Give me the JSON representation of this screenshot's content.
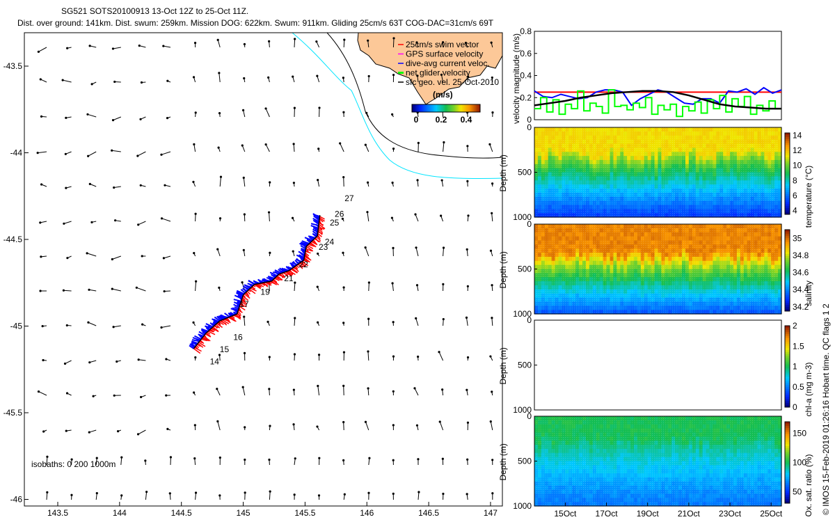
{
  "title": {
    "line1": "SG521 SOTS20100913 13-Oct 12Z to 25-Oct 11Z.",
    "line2": "Dist. over ground: 141km. Dist. swum: 259km. Mission DOG: 622km. Swum: 911km. Gliding 25cm/s 63T COG-DAC=31cm/s 69T"
  },
  "colors": {
    "swim": "#ff0000",
    "gps": "#ff00ff",
    "dac": "#0000ff",
    "net": "#00ff00",
    "geo": "#000000",
    "land": "#fcc898",
    "isobath200": "#00e5ff",
    "isobath1000": "#000000"
  },
  "chart_data": [
    {
      "type": "map",
      "name": "track-map",
      "xlim": [
        143.2,
        147.1
      ],
      "ylim": [
        -46.05,
        -43.3
      ],
      "xticks": [
        "143.5",
        "144",
        "144.5",
        "145",
        "145.5",
        "146",
        "146.5",
        "147"
      ],
      "xtick_values": [
        143.5,
        144,
        144.5,
        145,
        145.5,
        146,
        146.5,
        147
      ],
      "yticks": [
        "-43.5",
        "-44",
        "-44.5",
        "-45",
        "-45.5",
        "-46"
      ],
      "ytick_values": [
        -43.5,
        -44,
        -44.5,
        -45,
        -45.5,
        -46
      ],
      "track": [
        [
          144.6,
          -45.13
        ],
        [
          144.7,
          -45.04
        ],
        [
          144.81,
          -44.97
        ],
        [
          144.95,
          -44.93
        ],
        [
          145.0,
          -44.82
        ],
        [
          145.09,
          -44.76
        ],
        [
          145.23,
          -44.74
        ],
        [
          145.29,
          -44.7
        ],
        [
          145.37,
          -44.68
        ],
        [
          145.49,
          -44.62
        ],
        [
          145.51,
          -44.54
        ],
        [
          145.6,
          -44.48
        ],
        [
          145.62,
          -44.36
        ]
      ],
      "day_labels": [
        {
          "label": "14",
          "lon": 144.73,
          "lat": -45.22
        },
        {
          "label": "15",
          "lon": 144.81,
          "lat": -45.15
        },
        {
          "label": "16",
          "lon": 144.92,
          "lat": -45.08
        },
        {
          "label": "17",
          "lon": 144.97,
          "lat": -44.89
        },
        {
          "label": "19",
          "lon": 145.14,
          "lat": -44.82
        },
        {
          "label": "21",
          "lon": 145.33,
          "lat": -44.74
        },
        {
          "label": "22",
          "lon": 145.45,
          "lat": -44.66
        },
        {
          "label": "23",
          "lon": 145.61,
          "lat": -44.56
        },
        {
          "label": "24",
          "lon": 145.66,
          "lat": -44.53
        },
        {
          "label": "25",
          "lon": 145.7,
          "lat": -44.42
        },
        {
          "label": "26",
          "lon": 145.74,
          "lat": -44.37
        },
        {
          "label": "27",
          "lon": 145.82,
          "lat": -44.28
        }
      ],
      "legend": [
        "25cm/s swim vector",
        "GPS surface velocity",
        "dive-avg current veloc.",
        "net glider velocity",
        "sfc geo. vel. 25-Oct-2010"
      ],
      "colorbar": {
        "label": "(m/s)",
        "ticks": [
          "0",
          "0.2",
          "0.4"
        ],
        "range": [
          0,
          0.5
        ]
      },
      "isobaths_label": "isobaths: 0   200  1000m"
    },
    {
      "type": "line",
      "name": "velocity-magnitude",
      "ylabel": "velocity magnitude (m/s)",
      "ylim": [
        0,
        0.8
      ],
      "yticks": [
        "0",
        "0.2",
        "0.4",
        "0.6",
        "0.8"
      ],
      "xlim_days": [
        0,
        12
      ],
      "series": [
        {
          "name": "swim",
          "color": "#ff0000",
          "values": [
            0.25,
            0.25
          ]
        },
        {
          "name": "dive-avg current",
          "color": "#0000ff",
          "values": [
            0.26,
            0.21,
            0.2,
            0.23,
            0.21,
            0.19,
            0.2,
            0.25,
            0.27,
            0.27,
            0.25,
            0.13,
            0.19,
            0.23,
            0.27,
            0.25,
            0.2,
            0.15,
            0.14,
            0.19,
            0.19,
            0.15,
            0.26,
            0.25,
            0.28,
            0.23,
            0.29,
            0.24,
            0.27
          ]
        },
        {
          "name": "net glider",
          "color": "#00ff00",
          "values": [
            0.1,
            0.2,
            0.07,
            0.18,
            0.05,
            0.14,
            0.1,
            0.26,
            0.08,
            0.15,
            0.12,
            0.06,
            0.27,
            0.12,
            0.13,
            0.09,
            0.15,
            0.11,
            0.2,
            0.05,
            0.13,
            0.09,
            0.14,
            0.03,
            0.12,
            0.08,
            0.16,
            0.06,
            0.18,
            0.1,
            0.22,
            0.07,
            0.19,
            0.12,
            0.21,
            0.05,
            0.13,
            0.08,
            0.17,
            0.1
          ]
        },
        {
          "name": "geostrophic",
          "color": "#000000",
          "values": [
            0.13,
            0.15,
            0.17,
            0.2,
            0.22,
            0.24,
            0.25,
            0.26,
            0.26,
            0.25,
            0.22,
            0.18,
            0.14,
            0.12,
            0.11,
            0.1,
            0.1
          ]
        }
      ]
    },
    {
      "type": "heatmap",
      "name": "temperature-section",
      "ylabel": "Depth (m)",
      "yticks": [
        "0",
        "500",
        "1000"
      ],
      "cbar_label": "temperature (°C)",
      "cbar_ticks": [
        "4",
        "6",
        "8",
        "10",
        "12",
        "14"
      ],
      "crange": [
        3.5,
        14.3
      ],
      "surface": 11.5,
      "mld": 300,
      "deep": 5.0
    },
    {
      "type": "heatmap",
      "name": "salinity-section",
      "ylabel": "Depth (m)",
      "yticks": [
        "0",
        "500",
        "1000"
      ],
      "cbar_label": "salinity",
      "cbar_ticks": [
        "34.2",
        "34.4",
        "34.6",
        "34.8",
        "35"
      ],
      "crange": [
        34.15,
        35.1
      ],
      "surface": 34.98,
      "mld": 330,
      "deep": 34.32
    },
    {
      "type": "heatmap",
      "name": "chl-section",
      "ylabel": "Depth (m)",
      "yticks": [
        "0",
        "500",
        "1000"
      ],
      "cbar_label": "chl-a (mg m-3)",
      "cbar_ticks": [
        "0",
        "0.5",
        "1",
        "1.5",
        "2"
      ],
      "crange": [
        0,
        2
      ],
      "empty": true
    },
    {
      "type": "heatmap",
      "name": "oxygen-section",
      "ylabel": "Depth (m)",
      "yticks": [
        "0",
        "500",
        "1000"
      ],
      "cbar_label": "Ox. sat. ratio (%)",
      "cbar_ticks": [
        "50",
        "100",
        "150"
      ],
      "crange": [
        30,
        170
      ],
      "surface": 100,
      "mld": 250,
      "deep": 62
    },
    {
      "type": "axis",
      "name": "time-axis",
      "ticks": [
        "15Oct",
        "17Oct",
        "19Oct",
        "21Oct",
        "23Oct",
        "25Oct"
      ],
      "tick_days": [
        1.5,
        3.5,
        5.5,
        7.5,
        9.5,
        11.5
      ]
    }
  ],
  "credit": "© IMOS 15-Feb-2019 01:26:16 Hobart time. QC flags 1  2"
}
